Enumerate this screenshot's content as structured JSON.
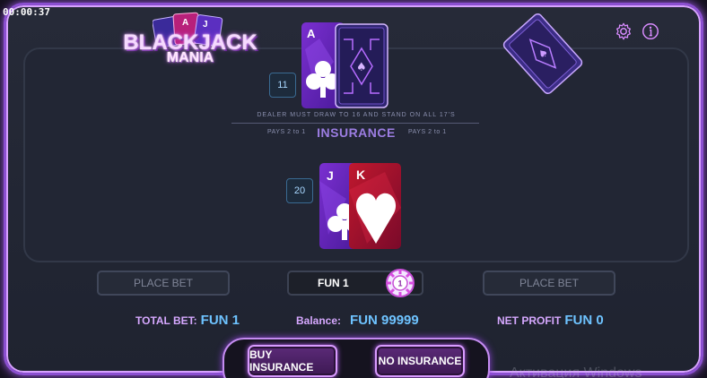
{
  "timer": "00:00:37",
  "logo": {
    "title": "BLACKJACK",
    "subtitle": "MANIA"
  },
  "header_icons": [
    "gear-icon",
    "info-icon"
  ],
  "dealer": {
    "score": "11",
    "cards": [
      {
        "rank": "A",
        "suit": "clubs",
        "face": "up"
      },
      {
        "rank": "",
        "suit": "",
        "face": "down"
      }
    ]
  },
  "rules": {
    "text": "DEALER MUST DRAW TO 16 AND STAND ON ALL 17'S",
    "pays_left": "PAYS 2 to 1",
    "insurance": "INSURANCE",
    "pays_right": "PAYS 2 to 1"
  },
  "player": {
    "score": "20",
    "cards": [
      {
        "rank": "J",
        "suit": "clubs",
        "face": "up"
      },
      {
        "rank": "K",
        "suit": "hearts",
        "face": "up"
      }
    ]
  },
  "bet_spots": {
    "left": "PLACE BET",
    "center": "FUN 1",
    "right": "PLACE BET",
    "chip_value": "1"
  },
  "stats": {
    "total_bet_label": "TOTAL BET:",
    "total_bet_value": "FUN 1",
    "balance_label": "Balance:",
    "balance_value": "FUN 99999",
    "net_profit_label": "NET PROFIT",
    "net_profit_value": "FUN 0"
  },
  "actions": {
    "buy_insurance": "BUY INSURANCE",
    "no_insurance": "NO INSURANCE"
  },
  "watermark": "Активация Windows",
  "colors": {
    "accent": "#b55ef0",
    "value_blue": "#6ec3ff",
    "label_pink": "#d6a8ff",
    "insurance": "#9c7de2"
  }
}
